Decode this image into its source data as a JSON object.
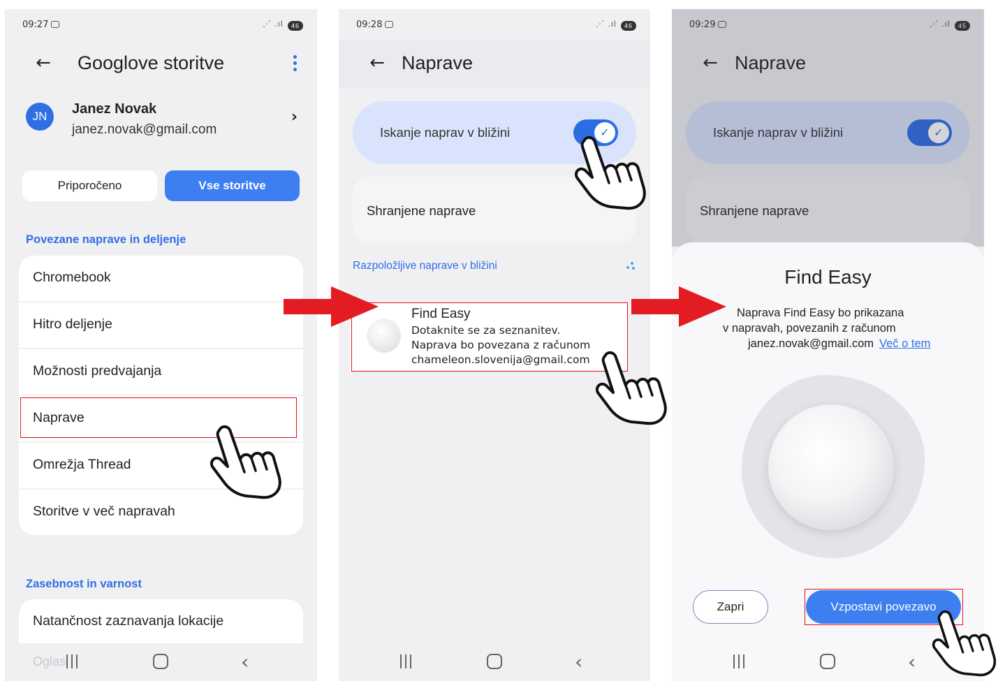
{
  "screen1": {
    "time": "09:27",
    "battery": "46",
    "title": "Googlove storitve",
    "account": {
      "initials": "JN",
      "name": "Janez Novak",
      "email": "janez.novak@gmail.com"
    },
    "tabs": [
      "Priporočeno",
      "Vse storitve"
    ],
    "section1": "Povezane naprave in deljenje",
    "items": [
      "Chromebook",
      "Hitro deljenje",
      "Možnosti predvajanja",
      "Naprave",
      "Omrežja Thread",
      "Storitve v več napravah"
    ],
    "section2": "Zasebnost in varnost",
    "privacy_item": "Natančnost zaznavanja lokacije",
    "clipped_item": "Oglasi"
  },
  "screen2": {
    "time": "09:28",
    "battery": "46",
    "title": "Naprave",
    "toggle_label": "Iskanje naprav v bližini",
    "saved_label": "Shranjene naprave",
    "nearby_title": "Razpoložljive naprave v bližini",
    "device": {
      "name": "Find Easy",
      "line1": "Dotaknite se za seznanitev.",
      "line2": "Naprava bo povezana z računom",
      "line3": "chameleon.slovenija@gmail.com"
    }
  },
  "screen3": {
    "time": "09:29",
    "battery": "45",
    "title": "Naprave",
    "toggle_label": "Iskanje naprav v bližini",
    "saved_label": "Shranjene naprave",
    "sheet": {
      "title": "Find Easy",
      "line1": "Naprava Find Easy bo prikazana",
      "line2": "v napravah, povezanih z računom",
      "email": "janez.novak@gmail.com",
      "link": "Več o tem",
      "close": "Zapri",
      "connect": "Vzpostavi povezavo"
    }
  },
  "colors": {
    "accent": "#2f6fe4",
    "highlight": "#e0101a",
    "arrow": "#e31b23"
  },
  "icons": [
    "back-arrow-icon",
    "more-vert-icon",
    "chevron-right-icon",
    "checkmark-icon",
    "loading-spinner-icon",
    "recent-apps-icon",
    "home-icon",
    "nav-back-icon",
    "pointing-hand-icon",
    "red-arrow-icon"
  ]
}
